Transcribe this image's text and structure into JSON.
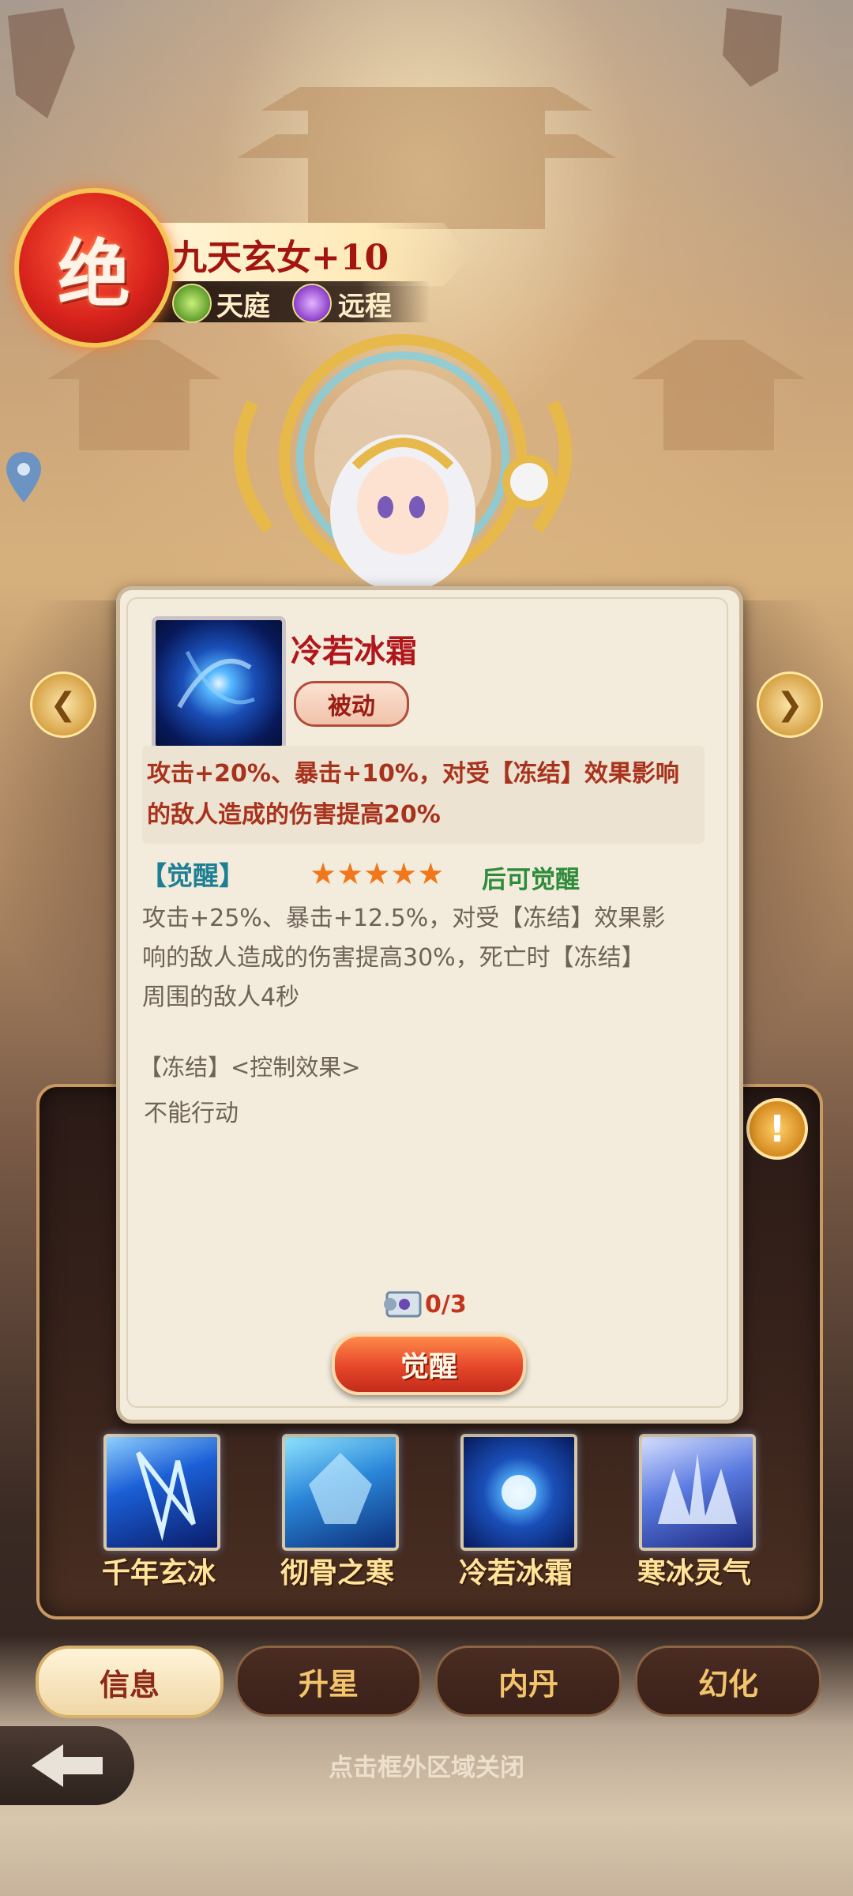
{
  "hero": {
    "rank_char": "绝",
    "name": "九天玄女+10",
    "faction": "天庭",
    "range": "远程"
  },
  "skill_detail": {
    "title": "冷若冰霜",
    "type": "被动",
    "effect": "攻击+20%、暴击+10%，对受【冻结】效果影响\n的敌人造成的伤害提高20%",
    "awaken_label": "【觉醒】",
    "awaken_stars": 5,
    "awaken_stars_text": "★★★★★",
    "awaken_condition": "后可觉醒",
    "awaken_effect": "攻击+25%、暴击+12.5%，对受【冻结】效果影\n响的敌人造成的伤害提高30%，死亡时【冻结】\n周围的敌人4秒",
    "freeze_label": "【冻结】<控制效果>",
    "freeze_desc": "不能行动",
    "material_count": "0/3",
    "awaken_button": "觉醒"
  },
  "skills": [
    {
      "name": "千年玄冰"
    },
    {
      "name": "彻骨之寒"
    },
    {
      "name": "冷若冰霜"
    },
    {
      "name": "寒冰灵气"
    }
  ],
  "tabs": [
    {
      "label": "信息",
      "active": true
    },
    {
      "label": "升星",
      "active": false
    },
    {
      "label": "内丹",
      "active": false
    },
    {
      "label": "幻化",
      "active": false
    }
  ],
  "close_hint": "点击框外区域关闭",
  "colors": {
    "title_red": "#b0161a",
    "awaken_teal": "#1d7f94",
    "star_orange": "#f0771a",
    "condition_green": "#2e8b3a",
    "skill_name_gold": "#ffe49a"
  },
  "icons": {
    "map_pin": "map-pin-icon",
    "nav_left": "chevron-left-icon",
    "nav_right": "chevron-right-icon",
    "info": "exclamation-icon",
    "scroll": "scroll-icon",
    "back": "back-arrow-icon"
  }
}
